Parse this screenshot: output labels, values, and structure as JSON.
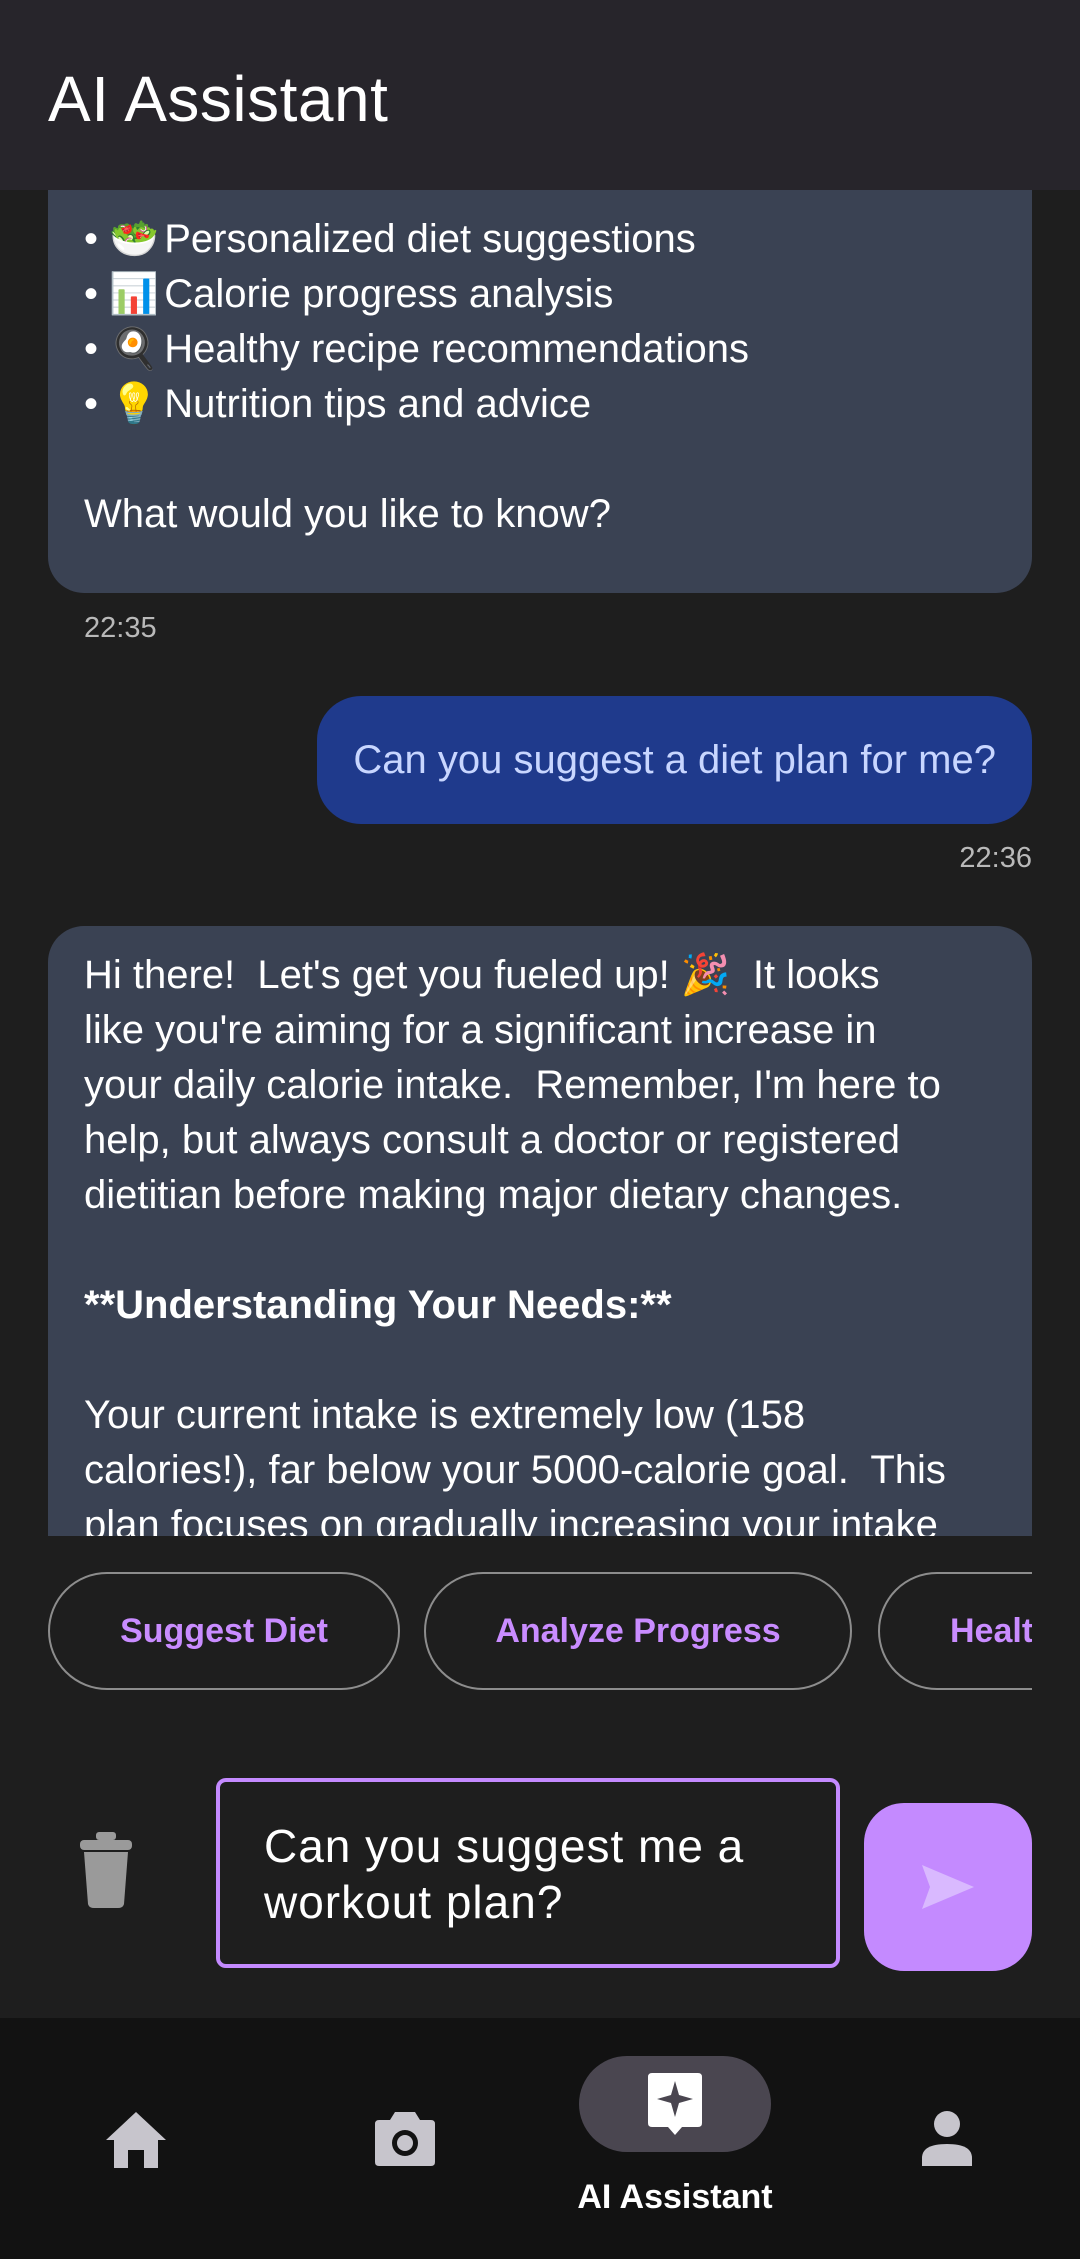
{
  "appbar": {
    "title": "AI Assistant"
  },
  "messages": {
    "ai1": {
      "lines": [
        {
          "emoji": "🥗",
          "text": "Personalized diet suggestions"
        },
        {
          "emoji": "📊",
          "text": "Calorie progress analysis"
        },
        {
          "emoji": "🍳",
          "text": "Healthy recipe recommendations"
        },
        {
          "emoji": "💡",
          "text": "Nutrition tips and advice"
        }
      ],
      "question": "What would you like to know?",
      "time": "22:35"
    },
    "user1": {
      "text": "Can you suggest a diet plan for me?",
      "time": "22:36"
    },
    "ai2": {
      "para1": [
        "Hi there!  Let's get you fueled up! 🎉  It looks",
        "like you're aiming for a significant increase in",
        "your daily calorie intake.  Remember, I'm here to",
        "help, but always consult a doctor or registered",
        "dietitian before making major dietary changes."
      ],
      "heading": "**Understanding Your Needs:**",
      "para2": [
        "Your current intake is extremely low (158",
        "calories!), far below your 5000-calorie goal.  This",
        "plan focuses on gradually increasing your intake"
      ]
    }
  },
  "chips": [
    "Suggest Diet",
    "Analyze Progress",
    "Healthy Recipes"
  ],
  "composer": {
    "input_value": "Can you suggest me a\nworkout plan?"
  },
  "nav": {
    "items": [
      {
        "icon": "home-icon"
      },
      {
        "icon": "camera-icon"
      },
      {
        "icon": "ai-sparkle-icon",
        "label": "AI Assistant"
      },
      {
        "icon": "profile-icon"
      }
    ]
  },
  "colors": {
    "ai_bubble": "#3a4253",
    "user_bubble": "#1f3a8c",
    "accent": "#c48aff",
    "appbar": "#27252b"
  }
}
